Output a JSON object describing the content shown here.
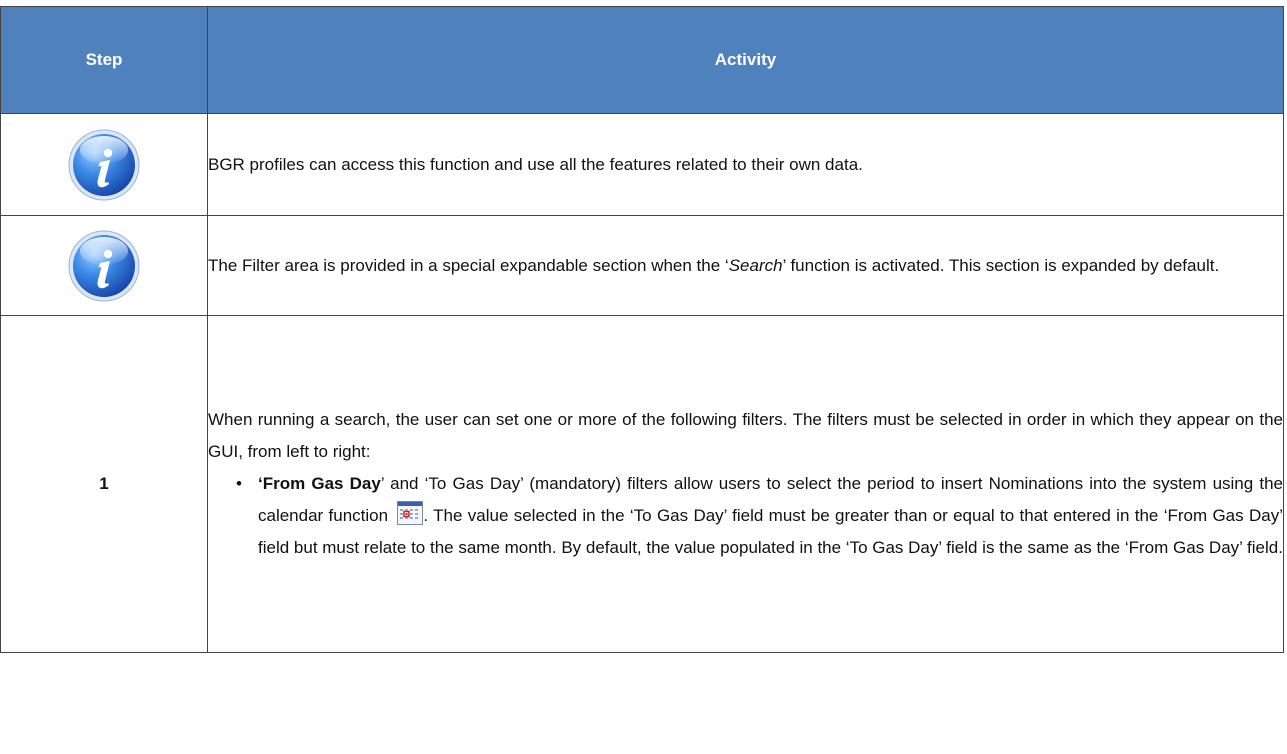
{
  "table": {
    "headers": {
      "step": "Step",
      "activity": "Activity"
    },
    "rows": [
      {
        "step_icon": "info-icon",
        "text": "BGR profiles can access this function and use all the features related to their own data."
      },
      {
        "step_icon": "info-icon",
        "text_before": "The Filter area is provided in a special expandable section when the ‘",
        "text_italic": "Search",
        "text_after": "’ function is activated. This section is expanded by default."
      },
      {
        "step": "1",
        "intro": "When running a search, the user can set one or more of the following filters. The filters must be selected in  order in which they appear on the GUI, from left to right:",
        "bullet_symbol": "•",
        "bullet_bold": "‘From Gas Day",
        "bullet_part1": "’ and ‘To Gas Day’ (mandatory) filters allow users to select the period to insert Nominations into the system using the calendar function",
        "calendar_icon": "calendar-icon",
        "bullet_part2": ". The value selected in the ‘To Gas Day’ field must be greater than or equal to that entered in the ‘From Gas Day’ field but must relate to the same month. By default, the value populated in the ‘To Gas Day’ field is the same as the ‘From Gas Day’ field."
      }
    ]
  },
  "colors": {
    "header_bg": "#4f81bd",
    "header_text": "#ffffff",
    "border": "#444444",
    "icon_blue": "#2a6fd6"
  }
}
